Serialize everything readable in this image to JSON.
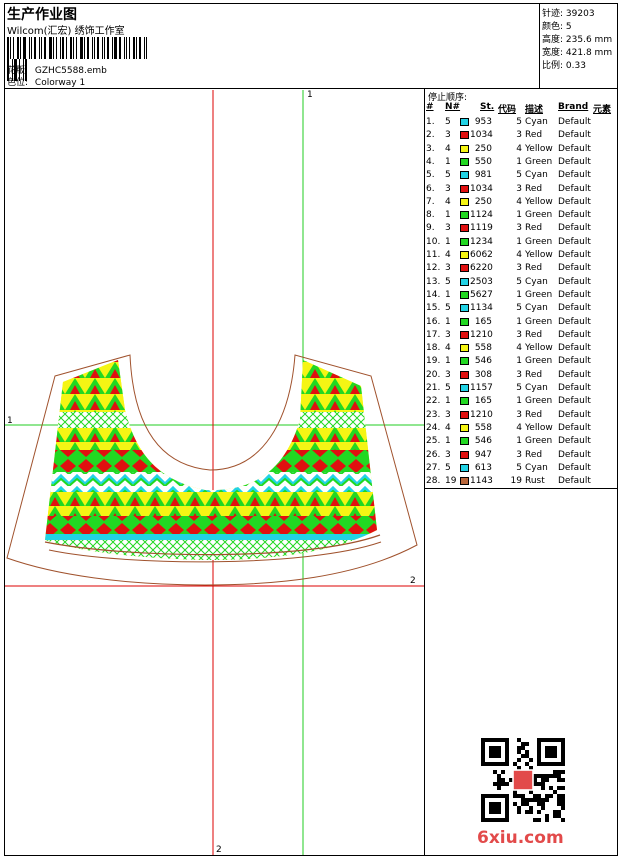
{
  "header": {
    "title": "生产作业图",
    "subtitle": "Wilcom(汇宏) 绣饰工作室",
    "design_label": "花版:",
    "design_value": "GZHC5588.emb",
    "colorway_label": "色位:",
    "colorway_value": "Colorway 1"
  },
  "stats": {
    "stitches_label": "针迹:",
    "stitches": "39203",
    "colors_label": "颜色:",
    "colors": "5",
    "height_label": "高度:",
    "height": "235.6 mm",
    "width_label": "宽度:",
    "width": "421.8 mm",
    "scale_label": "比例:",
    "scale": "0.33"
  },
  "stop_sequence": {
    "title": "停止顺序:",
    "columns": [
      "#",
      "N#",
      "St.",
      "代码",
      "描述",
      "Brand",
      "元素"
    ],
    "rows": [
      {
        "n": "1.",
        "nn": "5",
        "color": "#22d3e6",
        "st": "953",
        "code": "5",
        "desc": "Cyan",
        "brand": "Default"
      },
      {
        "n": "2.",
        "nn": "3",
        "color": "#e01010",
        "st": "1034",
        "code": "3",
        "desc": "Red",
        "brand": "Default"
      },
      {
        "n": "3.",
        "nn": "4",
        "color": "#f5f514",
        "st": "250",
        "code": "4",
        "desc": "Yellow",
        "brand": "Default"
      },
      {
        "n": "4.",
        "nn": "1",
        "color": "#22d822",
        "st": "550",
        "code": "1",
        "desc": "Green",
        "brand": "Default"
      },
      {
        "n": "5.",
        "nn": "5",
        "color": "#22d3e6",
        "st": "981",
        "code": "5",
        "desc": "Cyan",
        "brand": "Default"
      },
      {
        "n": "6.",
        "nn": "3",
        "color": "#e01010",
        "st": "1034",
        "code": "3",
        "desc": "Red",
        "brand": "Default"
      },
      {
        "n": "7.",
        "nn": "4",
        "color": "#f5f514",
        "st": "250",
        "code": "4",
        "desc": "Yellow",
        "brand": "Default"
      },
      {
        "n": "8.",
        "nn": "1",
        "color": "#22d822",
        "st": "1124",
        "code": "1",
        "desc": "Green",
        "brand": "Default"
      },
      {
        "n": "9.",
        "nn": "3",
        "color": "#e01010",
        "st": "1119",
        "code": "3",
        "desc": "Red",
        "brand": "Default"
      },
      {
        "n": "10.",
        "nn": "1",
        "color": "#22d822",
        "st": "1234",
        "code": "1",
        "desc": "Green",
        "brand": "Default"
      },
      {
        "n": "11.",
        "nn": "4",
        "color": "#f5f514",
        "st": "6062",
        "code": "4",
        "desc": "Yellow",
        "brand": "Default"
      },
      {
        "n": "12.",
        "nn": "3",
        "color": "#e01010",
        "st": "6220",
        "code": "3",
        "desc": "Red",
        "brand": "Default"
      },
      {
        "n": "13.",
        "nn": "5",
        "color": "#22d3e6",
        "st": "2503",
        "code": "5",
        "desc": "Cyan",
        "brand": "Default"
      },
      {
        "n": "14.",
        "nn": "1",
        "color": "#22d822",
        "st": "5627",
        "code": "1",
        "desc": "Green",
        "brand": "Default"
      },
      {
        "n": "15.",
        "nn": "5",
        "color": "#22d3e6",
        "st": "1134",
        "code": "5",
        "desc": "Cyan",
        "brand": "Default"
      },
      {
        "n": "16.",
        "nn": "1",
        "color": "#22d822",
        "st": "165",
        "code": "1",
        "desc": "Green",
        "brand": "Default"
      },
      {
        "n": "17.",
        "nn": "3",
        "color": "#e01010",
        "st": "1210",
        "code": "3",
        "desc": "Red",
        "brand": "Default"
      },
      {
        "n": "18.",
        "nn": "4",
        "color": "#f5f514",
        "st": "558",
        "code": "4",
        "desc": "Yellow",
        "brand": "Default"
      },
      {
        "n": "19.",
        "nn": "1",
        "color": "#22d822",
        "st": "546",
        "code": "1",
        "desc": "Green",
        "brand": "Default"
      },
      {
        "n": "20.",
        "nn": "3",
        "color": "#e01010",
        "st": "308",
        "code": "3",
        "desc": "Red",
        "brand": "Default"
      },
      {
        "n": "21.",
        "nn": "5",
        "color": "#22d3e6",
        "st": "1157",
        "code": "5",
        "desc": "Cyan",
        "brand": "Default"
      },
      {
        "n": "22.",
        "nn": "1",
        "color": "#22d822",
        "st": "165",
        "code": "1",
        "desc": "Green",
        "brand": "Default"
      },
      {
        "n": "23.",
        "nn": "3",
        "color": "#e01010",
        "st": "1210",
        "code": "3",
        "desc": "Red",
        "brand": "Default"
      },
      {
        "n": "24.",
        "nn": "4",
        "color": "#f5f514",
        "st": "558",
        "code": "4",
        "desc": "Yellow",
        "brand": "Default"
      },
      {
        "n": "25.",
        "nn": "1",
        "color": "#22d822",
        "st": "546",
        "code": "1",
        "desc": "Green",
        "brand": "Default"
      },
      {
        "n": "26.",
        "nn": "3",
        "color": "#e01010",
        "st": "947",
        "code": "3",
        "desc": "Red",
        "brand": "Default"
      },
      {
        "n": "27.",
        "nn": "5",
        "color": "#22d3e6",
        "st": "613",
        "code": "5",
        "desc": "Cyan",
        "brand": "Default"
      },
      {
        "n": "28.",
        "nn": "19",
        "color": "#b8663a",
        "st": "1143",
        "code": "19",
        "desc": "Rust",
        "brand": "Default"
      }
    ]
  },
  "canvas": {
    "axis_top": "1",
    "axis_left": "1",
    "axis_right": "2",
    "axis_bottom": "2",
    "guide_green": "#22cc22",
    "guide_red": "#dd0000",
    "outline_color": "#a0522d"
  },
  "watermark": {
    "text": "6xiu.com",
    "color": "#e24a4a"
  },
  "icons": {
    "qr": "qr-code-icon",
    "seal": "seal-stamp-icon"
  }
}
